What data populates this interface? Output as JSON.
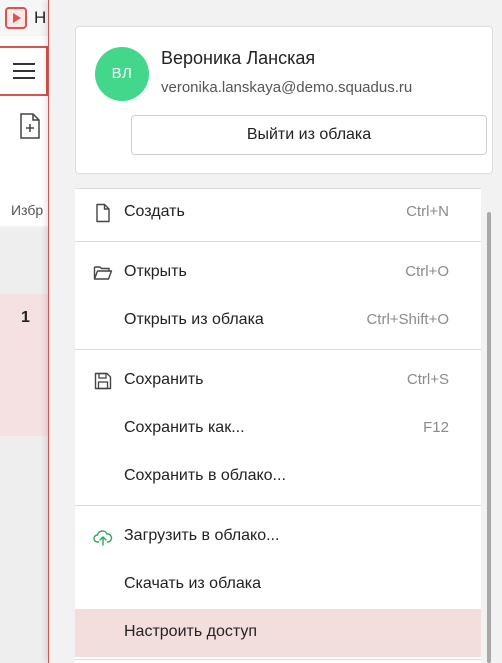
{
  "app": {
    "title_visible": "Н",
    "favorites_label": "Избр",
    "row_number": "1"
  },
  "account": {
    "avatar_initials": "ВЛ",
    "avatar_color": "#42d78a",
    "name": "Вероника Ланская",
    "email": "veronika.lanskaya@demo.squadus.ru",
    "logout_label": "Выйти из облака"
  },
  "menu": {
    "items": [
      {
        "label": "Создать",
        "shortcut": "Ctrl+N",
        "icon": "new-file-icon"
      },
      {
        "label": "Открыть",
        "shortcut": "Ctrl+O",
        "icon": "folder-open-icon"
      },
      {
        "label": "Открыть из облака",
        "shortcut": "Ctrl+Shift+O",
        "icon": ""
      },
      {
        "label": "Сохранить",
        "shortcut": "Ctrl+S",
        "icon": "save-icon"
      },
      {
        "label": "Сохранить как...",
        "shortcut": "F12",
        "icon": ""
      },
      {
        "label": "Сохранить в облако...",
        "shortcut": "",
        "icon": ""
      },
      {
        "label": "Загрузить в облако...",
        "shortcut": "",
        "icon": "cloud-upload-icon"
      },
      {
        "label": "Скачать из облака",
        "shortcut": "",
        "icon": ""
      },
      {
        "label": "Настроить доступ",
        "shortcut": "",
        "icon": "",
        "active": true
      }
    ]
  },
  "colors": {
    "accent": "#d9534f",
    "active_item_bg": "#f3dede",
    "cloud_icon": "#2aa55e"
  }
}
